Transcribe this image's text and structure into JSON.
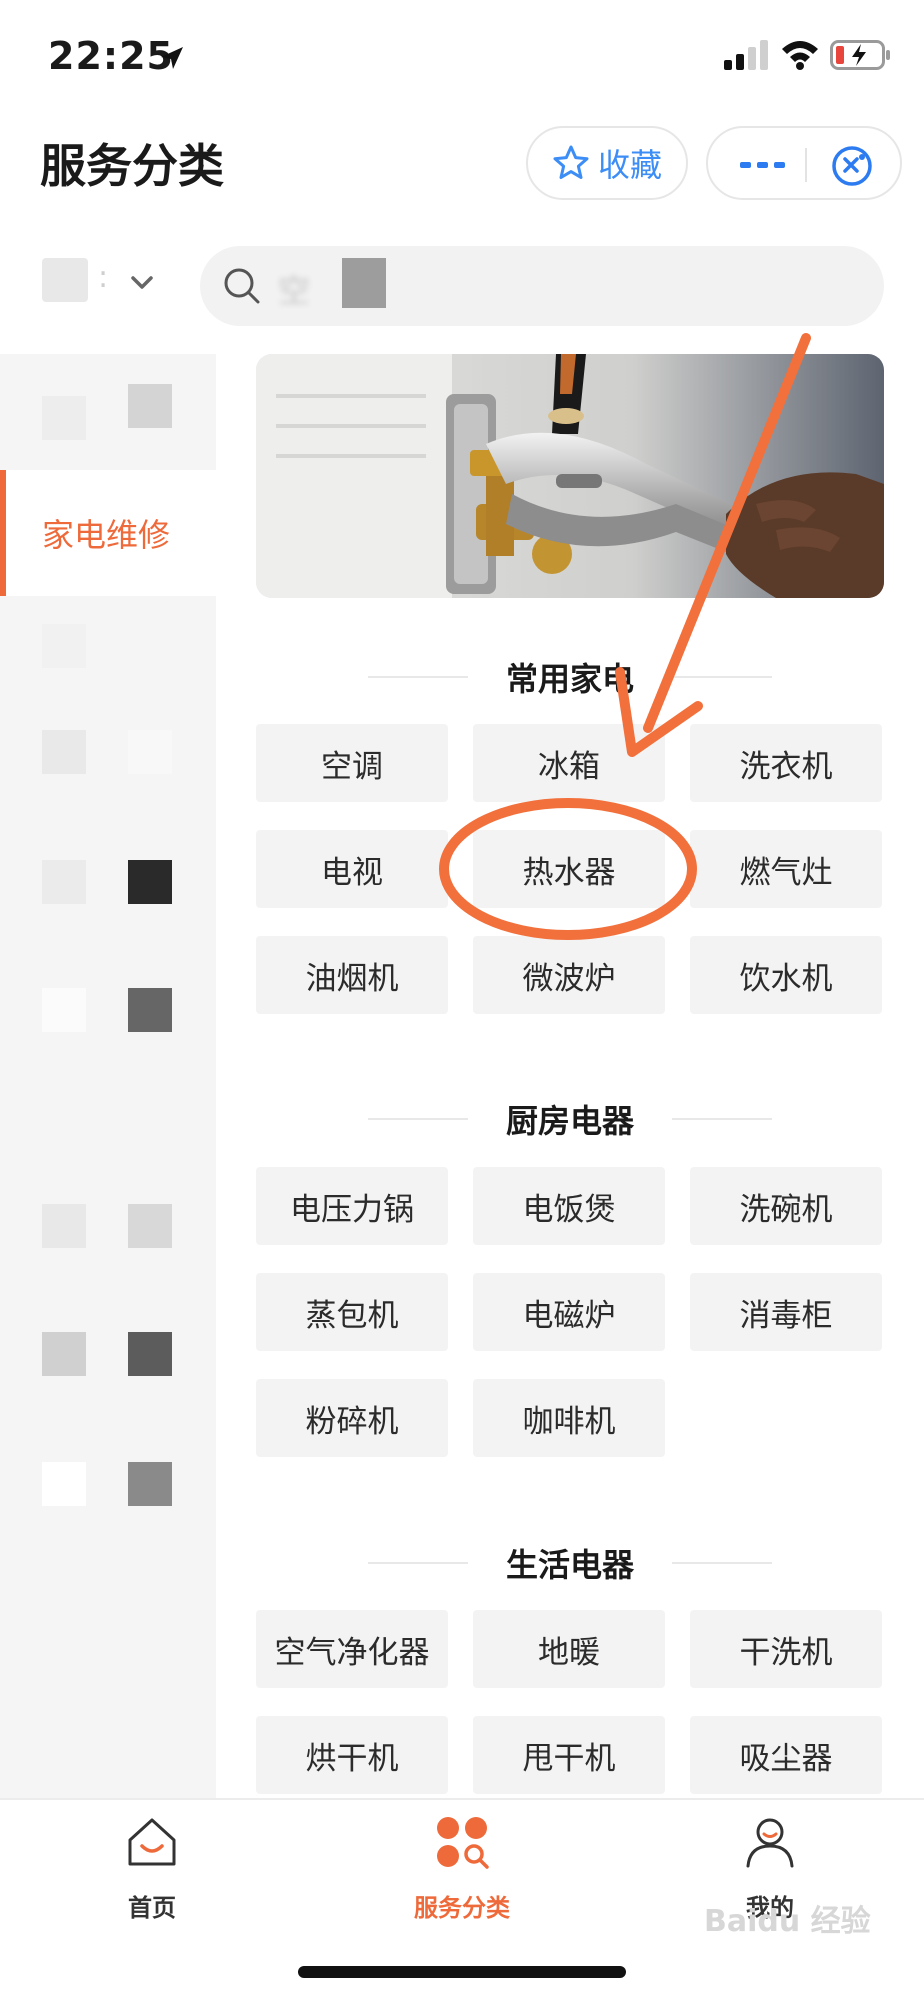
{
  "status_bar": {
    "time": "22:25"
  },
  "header": {
    "title": "服务分类",
    "favorite_label": "收藏"
  },
  "search": {
    "placeholder": "空"
  },
  "sidebar": {
    "active_item_label": "家电维修"
  },
  "sections": [
    {
      "title": "常用家电",
      "items": [
        "空调",
        "冰箱",
        "洗衣机",
        "电视",
        "热水器",
        "燃气灶",
        "油烟机",
        "微波炉",
        "饮水机"
      ]
    },
    {
      "title": "厨房电器",
      "items": [
        "电压力锅",
        "电饭煲",
        "洗碗机",
        "蒸包机",
        "电磁炉",
        "消毒柜",
        "粉碎机",
        "咖啡机"
      ]
    },
    {
      "title": "生活电器",
      "items": [
        "空气净化器",
        "地暖",
        "干洗机",
        "烘干机",
        "甩干机",
        "吸尘器"
      ]
    }
  ],
  "annotation": {
    "highlighted_item": "热水器",
    "color": "#f2703c"
  },
  "tabbar": [
    {
      "label": "首页",
      "icon": "home-icon",
      "active": false
    },
    {
      "label": "服务分类",
      "icon": "category-icon",
      "active": true
    },
    {
      "label": "我的",
      "icon": "profile-icon",
      "active": false
    }
  ],
  "watermark": "Baidu 经验",
  "colors": {
    "accent": "#ee6a3b",
    "favorite_blue": "#3c8df5",
    "button_bg": "#f3f3f3"
  }
}
